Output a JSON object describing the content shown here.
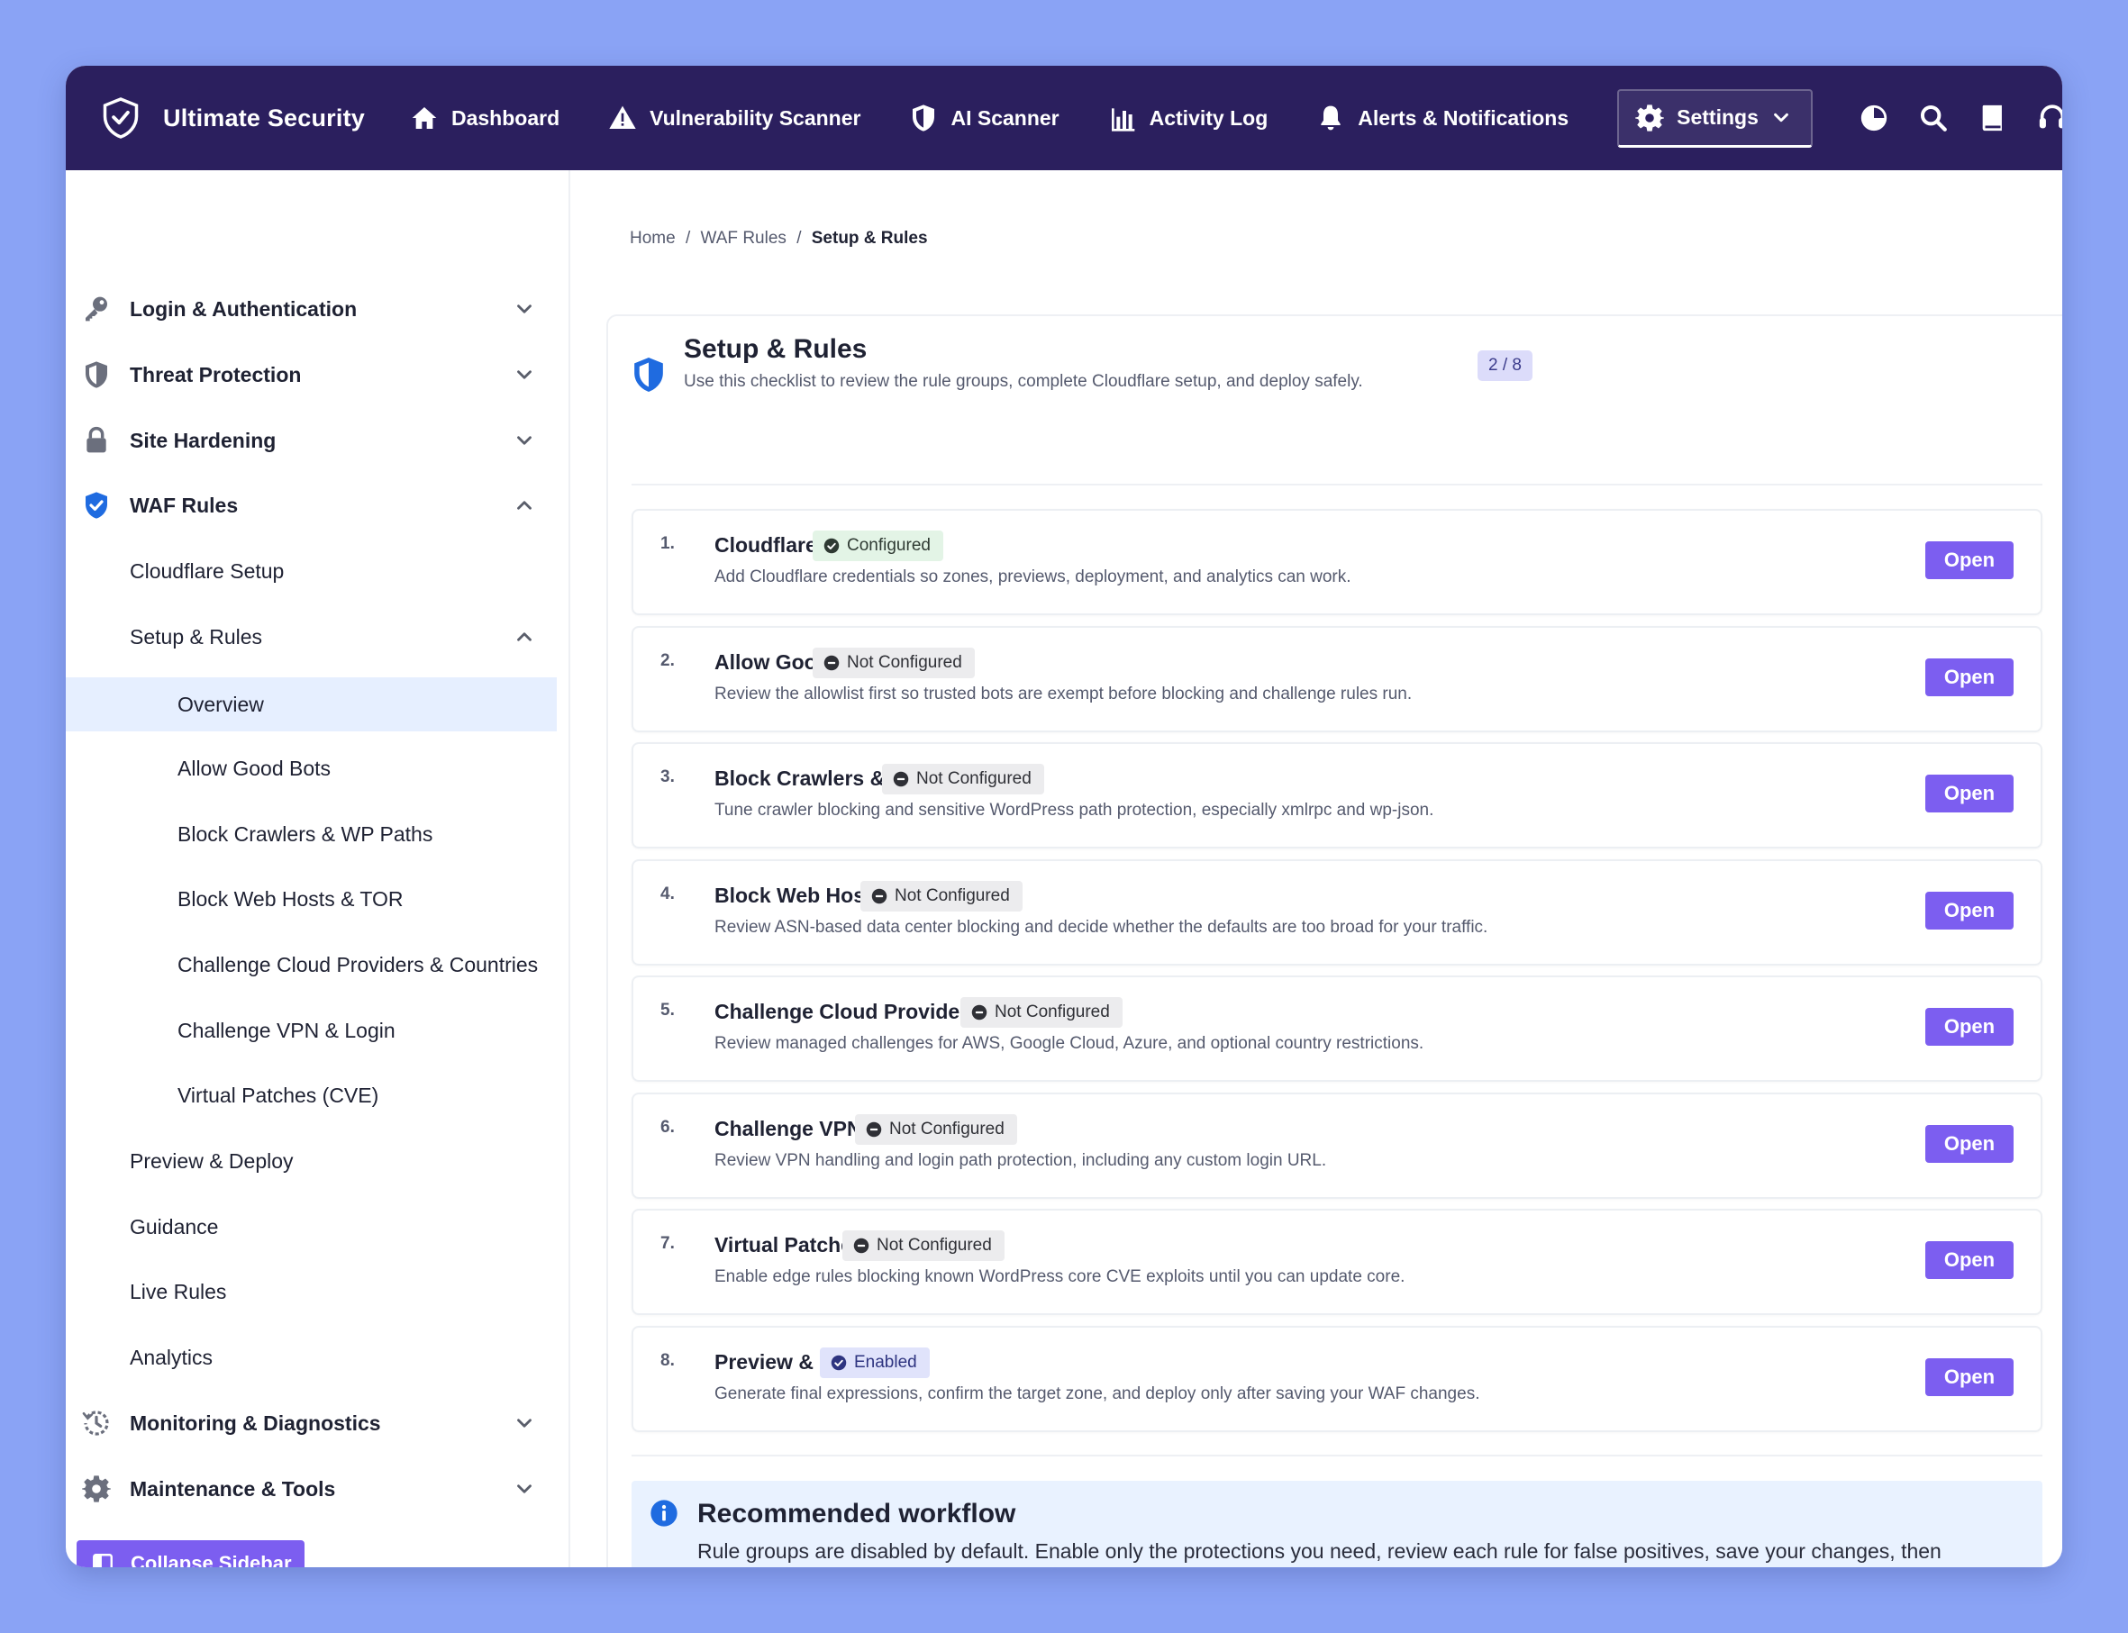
{
  "app": {
    "brand_name": "Ultimate Security",
    "accent_color": "#7c5ef0",
    "nav_background": "#2b1f5e"
  },
  "nav": {
    "items": [
      {
        "label": "Dashboard",
        "icon": "home-icon"
      },
      {
        "label": "Vulnerability Scanner",
        "icon": "warning-icon"
      },
      {
        "label": "AI Scanner",
        "icon": "shield-icon"
      },
      {
        "label": "Activity Log",
        "icon": "bar-chart-icon"
      },
      {
        "label": "Alerts & Notifications",
        "icon": "bell-icon"
      },
      {
        "label": "Settings",
        "icon": "gear-icon",
        "active": true
      }
    ],
    "tools": [
      "theme-toggle-icon",
      "search-icon",
      "book-icon",
      "headset-icon"
    ]
  },
  "sidebar": {
    "groups": [
      {
        "label": "Login & Authentication",
        "icon": "key-icon",
        "expanded": false
      },
      {
        "label": "Threat Protection",
        "icon": "shield-icon",
        "expanded": false
      },
      {
        "label": "Site Hardening",
        "icon": "lock-icon",
        "expanded": false
      },
      {
        "label": "WAF Rules",
        "icon": "shield-check-icon",
        "expanded": true
      },
      {
        "label": "Monitoring & Diagnostics",
        "icon": "history-icon",
        "expanded": false
      },
      {
        "label": "Maintenance & Tools",
        "icon": "gear-icon",
        "expanded": false
      }
    ],
    "waf_items": [
      "Cloudflare Setup",
      "Setup & Rules",
      "Preview & Deploy",
      "Guidance",
      "Live Rules",
      "Analytics"
    ],
    "setup_items": [
      "Overview",
      "Allow Good Bots",
      "Block Crawlers & WP Paths",
      "Block Web Hosts & TOR",
      "Challenge Cloud Providers & Countries",
      "Challenge VPN & Login",
      "Virtual Patches (CVE)"
    ],
    "selected": "Overview",
    "collapse_label": "Collapse Sidebar"
  },
  "breadcrumb": {
    "items": [
      "Home",
      "WAF Rules"
    ],
    "separator": "/",
    "current": "Setup & Rules"
  },
  "card": {
    "title": "Setup & Rules",
    "subtitle": "Use this checklist to review the rule groups, complete Cloudflare setup, and deploy safely.",
    "progress": "2 / 8",
    "open_label": "Open",
    "items": [
      {
        "num": "1.",
        "title": "Cloudflare Setup",
        "status": "Configured",
        "status_type": "ok",
        "desc": "Add Cloudflare credentials so zones, previews, deployment, and analytics can work."
      },
      {
        "num": "2.",
        "title": "Allow Good Bots",
        "status": "Not Configured",
        "status_type": "off",
        "desc": "Review the allowlist first so trusted bots are exempt before blocking and challenge rules run."
      },
      {
        "num": "3.",
        "title": "Block Crawlers & WP Paths",
        "status": "Not Configured",
        "status_type": "off",
        "desc": "Tune crawler blocking and sensitive WordPress path protection, especially xmlrpc and wp-json."
      },
      {
        "num": "4.",
        "title": "Block Web Hosts & TOR",
        "status": "Not Configured",
        "status_type": "off",
        "desc": "Review ASN-based data center blocking and decide whether the defaults are too broad for your traffic."
      },
      {
        "num": "5.",
        "title": "Challenge Cloud Providers & Countries",
        "status": "Not Configured",
        "status_type": "off",
        "desc": "Review managed challenges for AWS, Google Cloud, Azure, and optional country restrictions."
      },
      {
        "num": "6.",
        "title": "Challenge VPN & Login",
        "status": "Not Configured",
        "status_type": "off",
        "desc": "Review VPN handling and login path protection, including any custom login URL."
      },
      {
        "num": "7.",
        "title": "Virtual Patches (CVE)",
        "status": "Not Configured",
        "status_type": "off",
        "desc": "Enable edge rules blocking known WordPress core CVE exploits until you can update core."
      },
      {
        "num": "8.",
        "title": "Preview & Deploy",
        "status": "Enabled",
        "status_type": "on",
        "desc": "Generate final expressions, confirm the target zone, and deploy only after saving your WAF changes."
      }
    ]
  },
  "workflow": {
    "title": "Recommended workflow",
    "text": "Rule groups are disabled by default. Enable only the protections you need, review each rule for false positives, save your changes, then preview and deploy."
  }
}
